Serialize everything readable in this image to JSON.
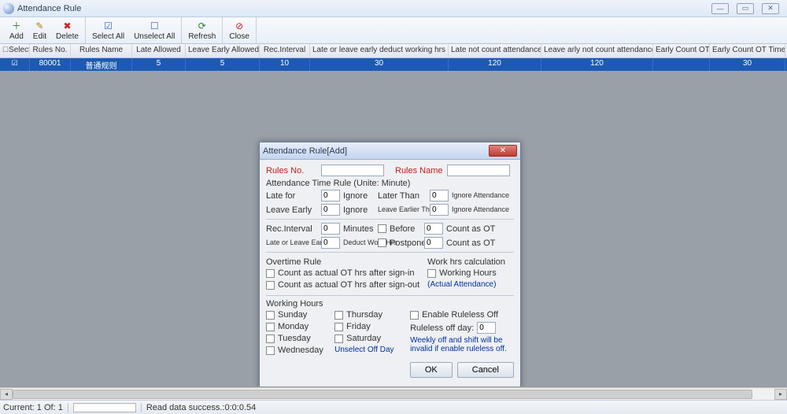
{
  "window": {
    "title": "Attendance Rule"
  },
  "toolbar": {
    "add": "Add",
    "edit": "Edit",
    "delete": "Delete",
    "select_all": "Select All",
    "unselect_all": "Unselect All",
    "refresh": "Refresh",
    "close": "Close"
  },
  "grid": {
    "headers": {
      "select": "Select",
      "rules_no": "Rules No.",
      "rules_name": "Rules Name",
      "late_allowed": "Late Allowed",
      "leave_early_allowed": "Leave Early Allowed",
      "rec_interval": "Rec.Interval",
      "deduct_hrs": "Late or leave early deduct working hrs",
      "late_not_count": "Late not count attendance",
      "leave_early_not_count": "Leave arly not count attendance",
      "early_count_ot": "Early Count OT",
      "early_count_ot_time": "Early Count OT Time"
    },
    "row": {
      "rules_no": "80001",
      "rules_name": "普通规则",
      "late_allowed": "5",
      "leave_early_allowed": "5",
      "rec_interval": "10",
      "deduct_hrs": "30",
      "late_not_count": "120",
      "leave_early_not_count": "120",
      "early_count_ot": "",
      "early_count_ot_time": "30"
    }
  },
  "modal": {
    "title": "Attendance Rule[Add]",
    "rules_no_lbl": "Rules No.",
    "rules_name_lbl": "Rules Name",
    "section_time": "Attendance Time Rule (Unite: Minute)",
    "late_for": "Late for",
    "ignore": "Ignore",
    "later_than": "Later Than",
    "ignore_attendance": "Ignore Attendance",
    "leave_early": "Leave Early",
    "leave_earlier_than": "Leave Earlier Than",
    "rec_interval": "Rec.Interval",
    "minutes": "Minutes",
    "before": "Before",
    "count_as_ot": "Count as OT",
    "late_or_leave": "Late or Leave Early",
    "deduct_work_hrs": "Deduct Work Hrs",
    "postpone": "Postpone",
    "zero": "0",
    "section_overtime": "Overtime Rule",
    "ot_signin": "Count as actual OT hrs after sign-in",
    "ot_signout": "Count as actual OT hrs after sign-out",
    "section_workcalc": "Work hrs calculation",
    "working_hours_ck": "Working Hours",
    "actual_att": "(Actual Attendance)",
    "section_working": "Working Hours",
    "sunday": "Sunday",
    "monday": "Monday",
    "tuesday": "Tuesday",
    "wednesday": "Wednesday",
    "thursday": "Thursday",
    "friday": "Friday",
    "saturday": "Saturday",
    "unselect_off": "Unselect Off Day",
    "enable_ruleless": "Enable Ruleless Off",
    "ruleless_day": "Ruleless off day:",
    "ruleless_val": "0",
    "ruleless_hint": "Weekly off and shift will be invalid if enable ruleless off.",
    "ok": "OK",
    "cancel": "Cancel"
  },
  "status": {
    "current": "Current: 1  Of: 1",
    "read": "Read data success.:0:0:0.54"
  }
}
